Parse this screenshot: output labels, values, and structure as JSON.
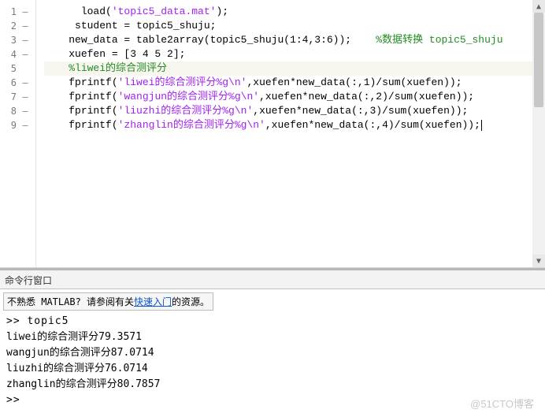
{
  "editor": {
    "lines": [
      {
        "num": "1",
        "dash": "—",
        "indent": "      ",
        "segments": [
          {
            "cls": "tok-plain",
            "t": "load("
          },
          {
            "cls": "tok-str",
            "t": "'topic5_data.mat'"
          },
          {
            "cls": "tok-plain",
            "t": ");"
          }
        ]
      },
      {
        "num": "2",
        "dash": "—",
        "indent": "     ",
        "segments": [
          {
            "cls": "tok-plain",
            "t": "student = topic5_shuju;"
          }
        ]
      },
      {
        "num": "3",
        "dash": "—",
        "indent": "    ",
        "segments": [
          {
            "cls": "tok-plain",
            "t": "new_data = table2array(topic5_shuju(1:4,3:6));    "
          },
          {
            "cls": "tok-cmt",
            "t": "%数据转换 topic5_shuju"
          }
        ]
      },
      {
        "num": "4",
        "dash": "—",
        "indent": "    ",
        "segments": [
          {
            "cls": "tok-plain",
            "t": "xuefen = [3 4 5 2];"
          }
        ]
      },
      {
        "num": "5",
        "dash": "",
        "indent": "    ",
        "bg": "line5-bg",
        "segments": [
          {
            "cls": "tok-cmt",
            "t": "%liwei的综合测评分"
          }
        ]
      },
      {
        "num": "6",
        "dash": "—",
        "indent": "    ",
        "segments": [
          {
            "cls": "tok-plain",
            "t": "fprintf("
          },
          {
            "cls": "tok-str",
            "t": "'liwei的综合测评分%g\\n'"
          },
          {
            "cls": "tok-plain",
            "t": ",xuefen*new_data(:,1)/sum(xuefen));"
          }
        ]
      },
      {
        "num": "7",
        "dash": "—",
        "indent": "    ",
        "segments": [
          {
            "cls": "tok-plain",
            "t": "fprintf("
          },
          {
            "cls": "tok-str",
            "t": "'wangjun的综合测评分%g\\n'"
          },
          {
            "cls": "tok-plain",
            "t": ",xuefen*new_data(:,2)/sum(xuefen));"
          }
        ]
      },
      {
        "num": "8",
        "dash": "—",
        "indent": "    ",
        "segments": [
          {
            "cls": "tok-plain",
            "t": "fprintf("
          },
          {
            "cls": "tok-str",
            "t": "'liuzhi的综合测评分%g\\n'"
          },
          {
            "cls": "tok-plain",
            "t": ",xuefen*new_data(:,3)/sum(xuefen));"
          }
        ]
      },
      {
        "num": "9",
        "dash": "—",
        "indent": "    ",
        "segments": [
          {
            "cls": "tok-plain",
            "t": "fprintf("
          },
          {
            "cls": "tok-str",
            "t": "'zhanglin的综合测评分%g\\n'"
          },
          {
            "cls": "tok-plain",
            "t": ",xuefen*new_data(:,4)/sum(xuefen));"
          }
        ],
        "caret": true
      }
    ]
  },
  "command": {
    "title": "命令行窗口",
    "hint_prefix": "不熟悉 MATLAB? 请参阅有关",
    "hint_link": "快速入门",
    "hint_suffix": "的资源。",
    "output": [
      ">> topic5",
      "liwei的综合测评分79.3571",
      "wangjun的综合测评分87.0714",
      "liuzhi的综合测评分76.0714",
      "zhanglin的综合测评分80.7857",
      ">> "
    ]
  },
  "watermark": "@51CTO博客"
}
